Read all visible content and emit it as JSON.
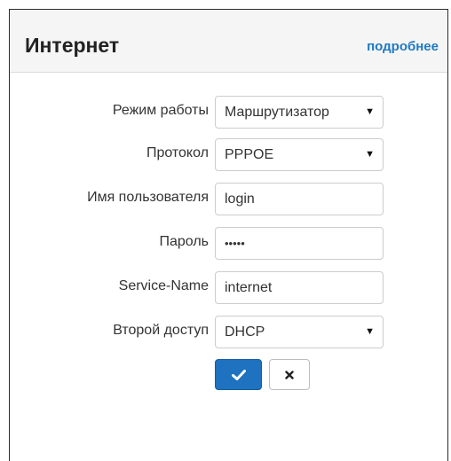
{
  "panel": {
    "title": "Интернет",
    "more_link": "подробнее"
  },
  "form": {
    "mode": {
      "label": "Режим работы",
      "value": "Маршрутизатор"
    },
    "protocol": {
      "label": "Протокол",
      "value": "PPPOE"
    },
    "username": {
      "label": "Имя пользователя",
      "value": "login"
    },
    "password": {
      "label": "Пароль",
      "value": "•••••"
    },
    "service_name": {
      "label": "Service-Name",
      "value": "internet"
    },
    "second_access": {
      "label": "Второй доступ",
      "value": "DHCP"
    }
  },
  "buttons": {
    "confirm_icon": "checkmark-icon",
    "cancel_icon": "close-icon"
  },
  "colors": {
    "link": "#1f7ac2",
    "primary_button": "#1e72c0"
  }
}
